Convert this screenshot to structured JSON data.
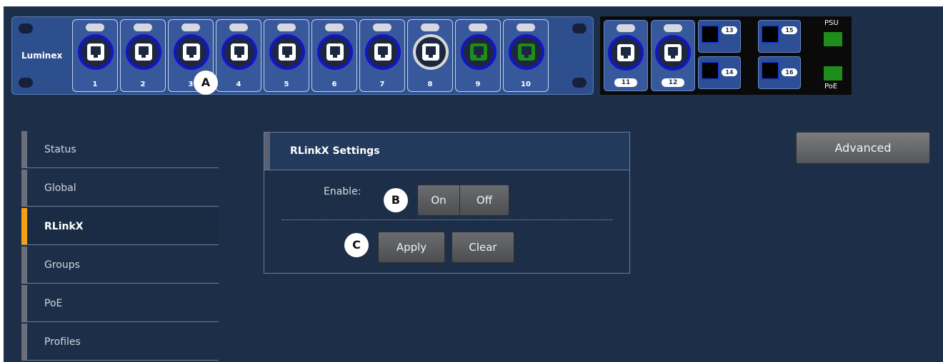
{
  "device": {
    "brand": "Luminex",
    "ports": [
      {
        "number": "1",
        "link": "white"
      },
      {
        "number": "2",
        "link": "white"
      },
      {
        "number": "3",
        "link": "white"
      },
      {
        "number": "4",
        "link": "white"
      },
      {
        "number": "5",
        "link": "white"
      },
      {
        "number": "6",
        "link": "white"
      },
      {
        "number": "7",
        "link": "white"
      },
      {
        "number": "8",
        "link": "white"
      },
      {
        "number": "9",
        "link": "green"
      },
      {
        "number": "10",
        "link": "green"
      }
    ],
    "combo_ports": [
      {
        "number": "11"
      },
      {
        "number": "12"
      }
    ],
    "sfp_ports": [
      "13",
      "14",
      "15",
      "16"
    ],
    "status": {
      "psu_label": "PSU",
      "poe_label": "PoE",
      "psu_color": "#1f8d1a",
      "poe_color": "#1f8d1a"
    }
  },
  "sidebar": {
    "items": [
      {
        "label": "Status"
      },
      {
        "label": "Global"
      },
      {
        "label": "RLinkX",
        "active": true
      },
      {
        "label": "Groups"
      },
      {
        "label": "PoE"
      },
      {
        "label": "Profiles"
      }
    ]
  },
  "panel": {
    "title": "RLinkX Settings",
    "enable_label": "Enable:",
    "on_label": "On",
    "off_label": "Off",
    "apply_label": "Apply",
    "clear_label": "Clear"
  },
  "advanced_label": "Advanced",
  "markers": {
    "a": "A",
    "b": "B",
    "c": "C"
  },
  "colors": {
    "accent": "#f6a012",
    "background": "#1d2f48",
    "port_ring": "#1414c8"
  }
}
